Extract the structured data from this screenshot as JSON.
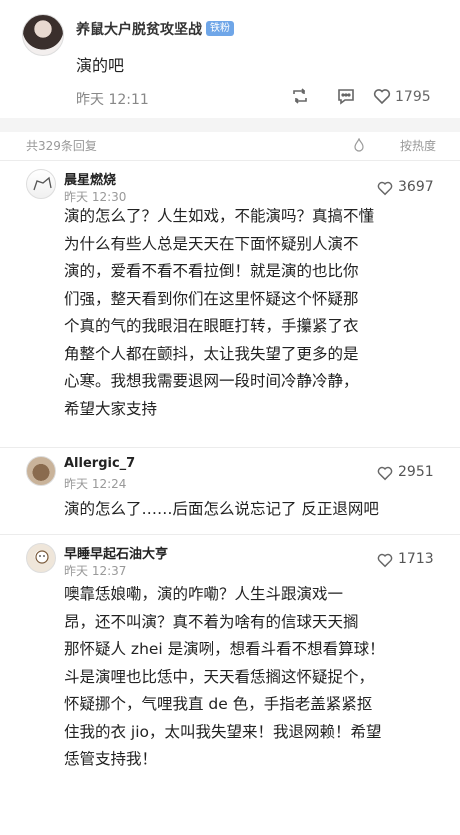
{
  "post": {
    "author": "养鼠大户脱贫攻坚战",
    "badge": "铁粉",
    "text": "演的吧",
    "time": "昨天 12:11",
    "likes": "1795",
    "icons": [
      "retweet-icon",
      "comment-icon",
      "like-icon"
    ]
  },
  "comments_header": {
    "total": "共329条回复",
    "sort": "按热度"
  },
  "comments": [
    {
      "name": "晨星燃烧",
      "time": "昨天 12:30",
      "likes": "3697",
      "lines": [
        "演的怎么了？人生如戏，不能演吗？真搞不懂",
        "为什么有些人总是天天在下面怀疑别人演不",
        "演的，爱看不看不看拉倒！就是演的也比你",
        "们强，整天看到你们在这里怀疑这个怀疑那",
        "个真的气的我眼泪在眼眶打转，手攥紧了衣",
        "角整个人都在颤抖，太让我失望了更多的是",
        "心寒。我想我需要退网一段时间冷静冷静，",
        "希望大家支持"
      ]
    },
    {
      "name": "Allergic_7",
      "time": "昨天 12:24",
      "likes": "2951",
      "lines": [
        "演的怎么了……后面怎么说忘记了 反正退网吧"
      ]
    },
    {
      "name": "早睡早起石油大亨",
      "time": "昨天 12:37",
      "likes": "1713",
      "lines": [
        "噢靠恁娘嘞，演的咋嘞？人生斗跟演戏一",
        "昂，还不叫演？真不着为啥有的信球天天搁",
        "那怀疑人 zhei 是演咧，想看斗看不想看算球！",
        "斗是演哩也比恁中，天天看恁搁这怀疑捉个，",
        "怀疑挪个，气哩我直 de 色，手指老盖紧紧抠",
        "住我的衣 jio，太叫我失望来！我退网赖！希望",
        "恁管支持我！"
      ]
    }
  ]
}
